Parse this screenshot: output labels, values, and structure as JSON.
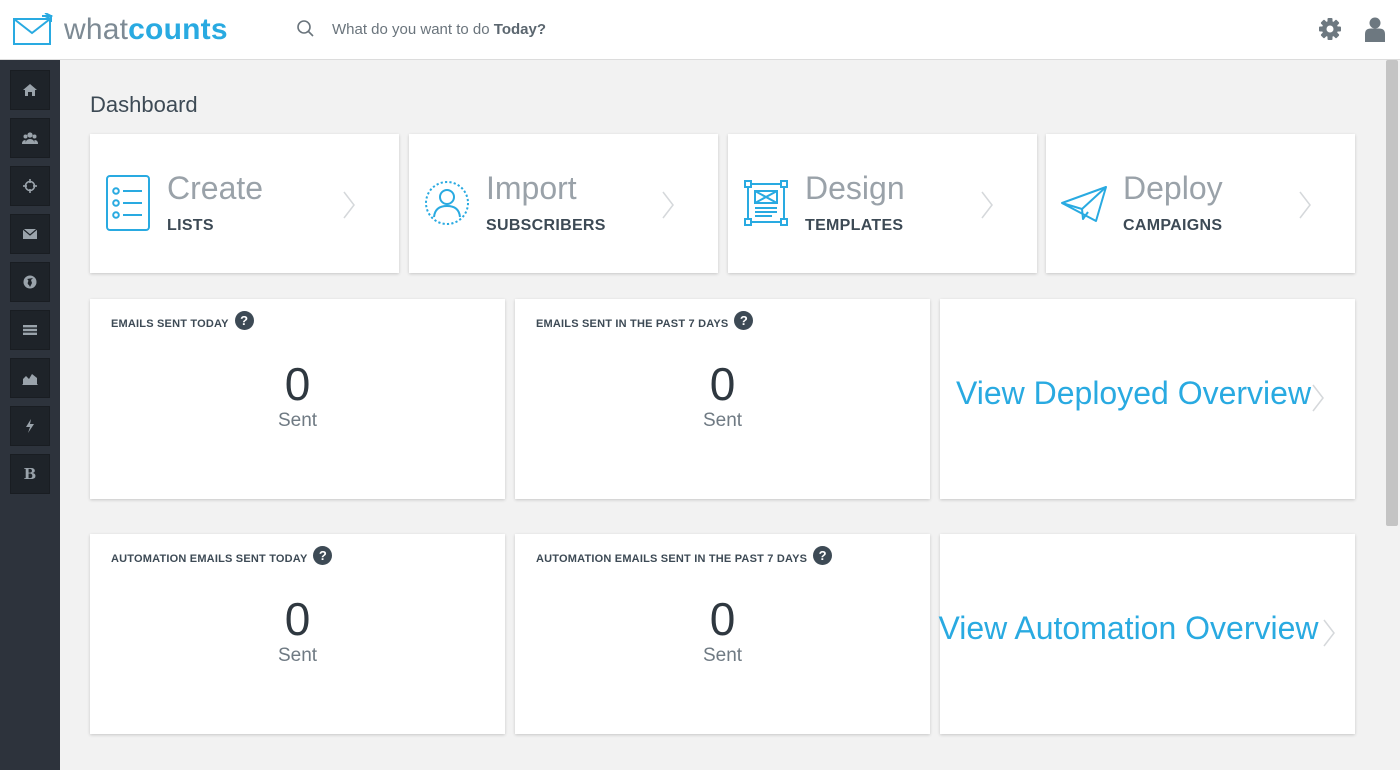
{
  "header": {
    "logo": {
      "what": "what",
      "counts": "counts"
    },
    "search": {
      "prefix": "What do you want to do ",
      "emphasis": "Today?"
    },
    "icons": [
      "gear-icon",
      "user-icon"
    ]
  },
  "sidebar": {
    "items": [
      {
        "icon": "home-icon"
      },
      {
        "icon": "users-icon"
      },
      {
        "icon": "crosshair-icon"
      },
      {
        "icon": "envelope-icon"
      },
      {
        "icon": "globe-icon"
      },
      {
        "icon": "list-icon"
      },
      {
        "icon": "chart-icon"
      },
      {
        "icon": "bolt-icon"
      },
      {
        "icon": "b-icon",
        "label": "B"
      }
    ]
  },
  "page": {
    "title": "Dashboard"
  },
  "actions": [
    {
      "title": "Create",
      "subtitle": "LISTS",
      "icon": "list-icon"
    },
    {
      "title": "Import",
      "subtitle": "SUBSCRIBERS",
      "icon": "subscriber-icon"
    },
    {
      "title": "Design",
      "subtitle": "TEMPLATES",
      "icon": "template-icon"
    },
    {
      "title": "Deploy",
      "subtitle": "CAMPAIGNS",
      "icon": "paper-plane-icon"
    }
  ],
  "stats": [
    {
      "label": "EMAILS SENT TODAY",
      "value": "0",
      "unit": "Sent"
    },
    {
      "label": "EMAILS SENT IN THE PAST 7 DAYS",
      "value": "0",
      "unit": "Sent"
    },
    {
      "label": "AUTOMATION EMAILS SENT TODAY",
      "value": "0",
      "unit": "Sent"
    },
    {
      "label": "AUTOMATION EMAILS SENT IN THE PAST 7 DAYS",
      "value": "0",
      "unit": "Sent"
    }
  ],
  "help_glyph": "?",
  "overviews": {
    "deployed": "View Deployed Overview",
    "automation": "View Automation Overview"
  },
  "colors": {
    "accent": "#29aae1",
    "sidebar": "#2d333c",
    "text": "#3d4a55"
  }
}
